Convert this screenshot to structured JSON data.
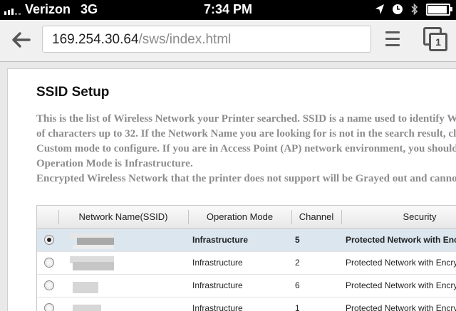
{
  "status_bar": {
    "carrier": "Verizon",
    "network": "3G",
    "time": "7:34 PM",
    "icons": [
      "location-arrow-icon",
      "clock-icon",
      "bluetooth-icon",
      "battery-icon"
    ],
    "battery_level": 0.85
  },
  "browser": {
    "url_host": "169.254.30.64",
    "url_path": "/sws/index.html",
    "tab_count": "1"
  },
  "page": {
    "title": "SSID Setup",
    "description_lines": [
      "This is the list of Wireless Network your Printer searched. SSID is a name used to identify Wire",
      "of characters up to 32. If the Network Name you are looking for is not in the search result, click",
      "Custom mode to configure. If you are in Access Point (AP) network environment, you should se",
      "Operation Mode is Infrastructure.",
      "Encrypted Wireless Network that the printer does not support will be Grayed out and cannot b"
    ]
  },
  "table": {
    "headers": [
      "",
      "Network Name(SSID)",
      "Operation Mode",
      "Channel",
      "Security"
    ],
    "rows": [
      {
        "selected": true,
        "ssid": "",
        "mode": "Infrastructure",
        "channel": "5",
        "security": "Protected Network with Encr"
      },
      {
        "selected": false,
        "ssid": "",
        "mode": "Infrastructure",
        "channel": "2",
        "security": "Protected Network with Encryp"
      },
      {
        "selected": false,
        "ssid": "",
        "mode": "Infrastructure",
        "channel": "6",
        "security": "Protected Network with Encryp"
      },
      {
        "selected": false,
        "ssid": "",
        "mode": "Infrastructure",
        "channel": "1",
        "security": "Protected Network with Encryp"
      }
    ]
  }
}
